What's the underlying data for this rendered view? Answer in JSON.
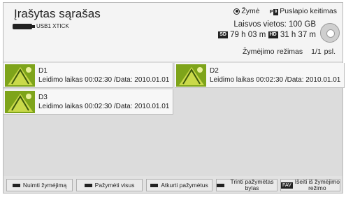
{
  "header": {
    "title": "Įrašytas sąrašas",
    "usb_label": "USB1 XTICK",
    "legend_mark": "Žymė",
    "legend_page_key": "P",
    "legend_page": "Puslapio keitimas",
    "free_space": "Laisvos vietos: 100 GB",
    "sd_badge": "SD",
    "sd_time": "79 h 03 m",
    "hd_badge": "HD",
    "hd_time": "31 h 37 m",
    "mode": "Žymėjimo režimas",
    "page": "1/1 psl."
  },
  "recordings": [
    {
      "name": "D1",
      "meta": "Leidimo laikas 00:02:30 /Data: 2010.01.01"
    },
    {
      "name": "D2",
      "meta": "Leidimo laikas 00:02:30 /Data: 2010.01.01"
    },
    {
      "name": "D3",
      "meta": "Leidimo laikas 00:02:30 /Data: 2010.01.01"
    }
  ],
  "footer": {
    "unmark": "Nuimti žymėjimą",
    "mark_all": "Pažymėti visus",
    "play_marked": "Atkurti pažymėtus",
    "delete_marked": "Trinti pažymėtas bylas",
    "fav_key": "FAV",
    "exit_mode": "Išeiti iš žymėjimo režimo"
  },
  "colors": {
    "thumbnail_green": "#7ea41a",
    "panel": "#dcdcdc"
  }
}
